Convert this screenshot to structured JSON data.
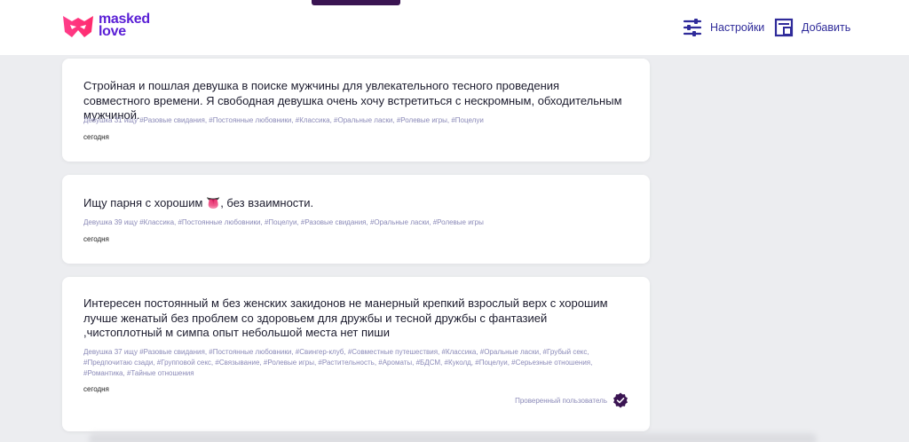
{
  "brand": {
    "line1": "masked",
    "line2": "love"
  },
  "nav": {
    "settings_label": "Настройки",
    "add_label": "Добавить"
  },
  "icons": {
    "logo": "masked-love-logo",
    "settings": "sliders-icon",
    "add": "add-listing-icon",
    "verified": "verified-badge-icon"
  },
  "colors": {
    "accent": "#2f2b9a",
    "brand": "#5a1fd6",
    "tag": "#8b8ab8",
    "top_bar": "#3a1452",
    "background": "#ecedf0"
  },
  "listings": [
    {
      "title": "Стройная и пошлая девушка в поиске мужчины для увлекательного тесного проведения совместного времени. Я свободная девушка очень хочу встретиться с нескромным, обходительным мужчиной.",
      "tags": "Девушка 31 ищу #Разовые свидания, #Постоянные любовники, #Классика, #Оральные ласки, #Ролевые игры, #Поцелуи",
      "date": "сегодня"
    },
    {
      "title": "Ищу парня с хорошим 👅, без взаимности.",
      "tags": "Девушка 39 ищу #Классика, #Постоянные любовники, #Поцелуи, #Разовые свидания, #Оральные ласки, #Ролевые игры",
      "date": "сегодня"
    },
    {
      "title": "Интересен постоянный м без женских закидонов не манерный крепкий взрослый верх с хорошим лучше женатый без проблем со здоровьем для дружбы и тесной дружбы с фантазией ,чистоплотный м симпа опыт небольшой места нет пиши",
      "tags": "Девушка 37 ищу #Разовые свидания, #Постоянные любовники, #Свингер-клуб, #Совместные путешествия, #Классика, #Оральные ласки, #Грубый секс, #Предпочитаю сзади, #Групповой секс, #Связывание, #Ролевые игры, #Растительность, #Ароматы, #БДСМ, #Куколд, #Поцелуи, #Серьезные отношения, #Романтика, #Тайные отношения",
      "date": "сегодня",
      "verified_label": "Проверенный пользователь"
    }
  ]
}
